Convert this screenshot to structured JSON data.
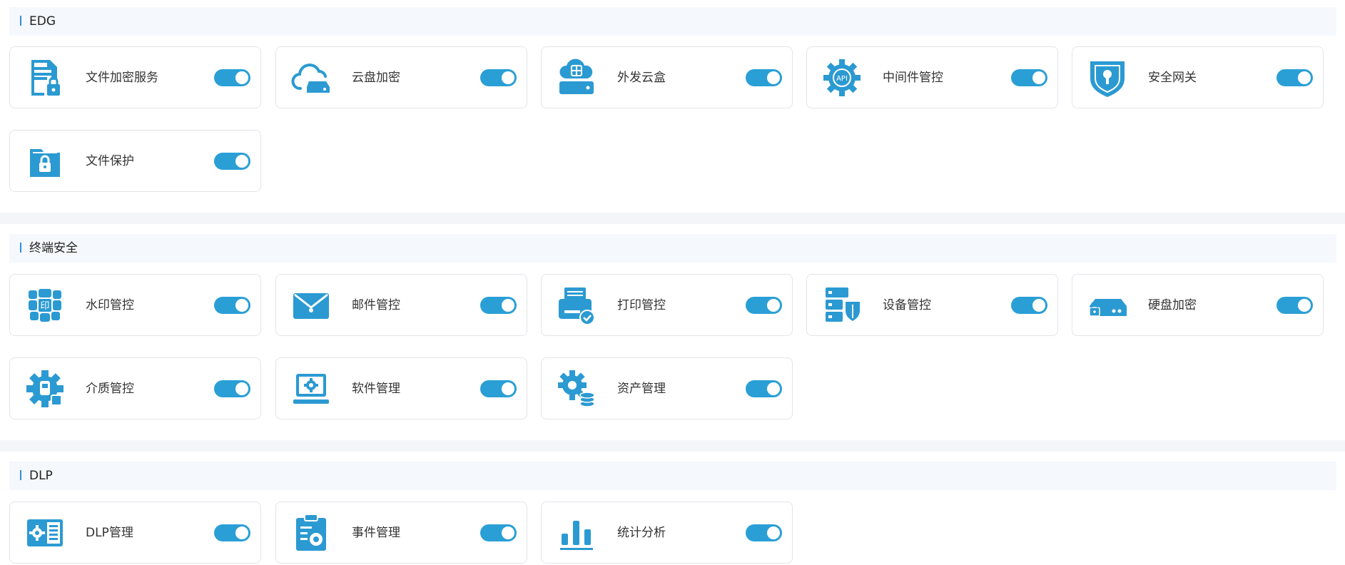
{
  "sections": [
    {
      "title": "EDG",
      "items": [
        {
          "label": "文件加密服务",
          "icon": "file-lock-icon",
          "enabled": true
        },
        {
          "label": "云盘加密",
          "icon": "cloud-drive-icon",
          "enabled": true
        },
        {
          "label": "外发云盒",
          "icon": "cloud-box-icon",
          "enabled": true
        },
        {
          "label": "中间件管控",
          "icon": "api-gear-icon",
          "enabled": true
        },
        {
          "label": "安全网关",
          "icon": "shield-lock-icon",
          "enabled": true
        },
        {
          "label": "文件保护",
          "icon": "folder-lock-icon",
          "enabled": true
        }
      ]
    },
    {
      "title": "终端安全",
      "items": [
        {
          "label": "水印管控",
          "icon": "watermark-icon",
          "enabled": true
        },
        {
          "label": "邮件管控",
          "icon": "mail-icon",
          "enabled": true
        },
        {
          "label": "打印管控",
          "icon": "printer-check-icon",
          "enabled": true
        },
        {
          "label": "设备管控",
          "icon": "server-shield-icon",
          "enabled": true
        },
        {
          "label": "硬盘加密",
          "icon": "disk-lock-icon",
          "enabled": true
        },
        {
          "label": "介质管控",
          "icon": "media-gear-icon",
          "enabled": true
        },
        {
          "label": "软件管理",
          "icon": "laptop-gear-icon",
          "enabled": true
        },
        {
          "label": "资产管理",
          "icon": "gear-database-icon",
          "enabled": true
        }
      ]
    },
    {
      "title": "DLP",
      "items": [
        {
          "label": "DLP管理",
          "icon": "settings-list-icon",
          "enabled": true
        },
        {
          "label": "事件管理",
          "icon": "clipboard-gear-icon",
          "enabled": true
        },
        {
          "label": "统计分析",
          "icon": "bar-chart-icon",
          "enabled": true
        }
      ]
    }
  ],
  "colors": {
    "accent": "#2a9fd6",
    "icon": "#2b9ad2",
    "section_bar": "#2f8fd8",
    "header_bg": "#f5f8fc"
  }
}
